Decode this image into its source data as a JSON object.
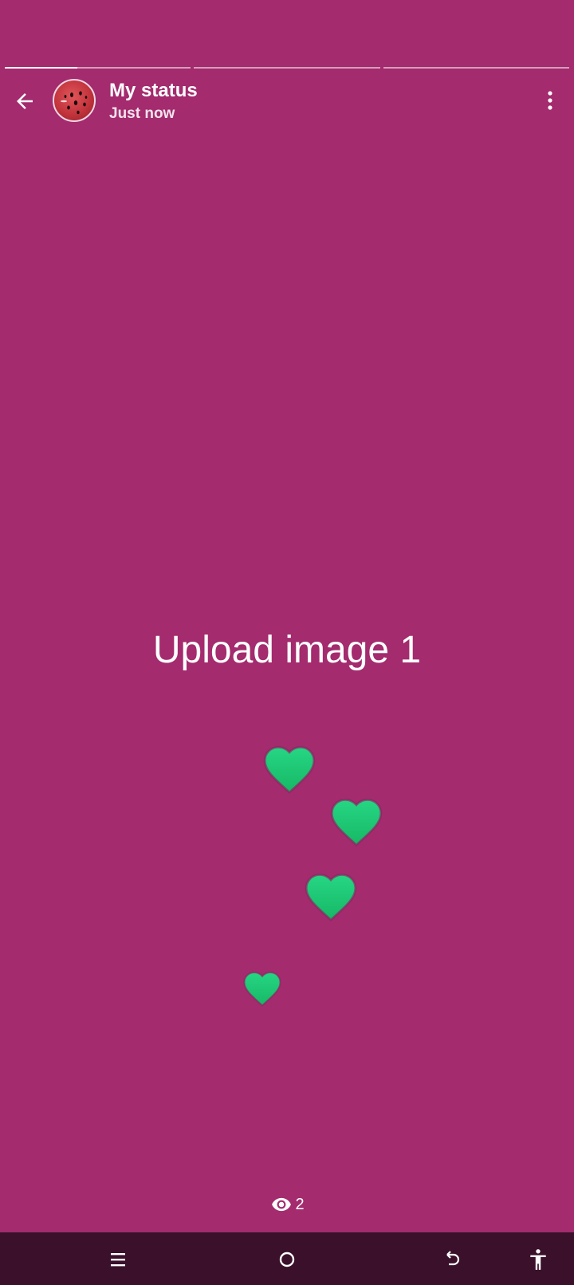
{
  "story": {
    "segments": [
      {
        "progress": 0.39
      },
      {
        "progress": 0
      },
      {
        "progress": 0
      }
    ]
  },
  "header": {
    "back_icon": "arrow-left-icon",
    "avatar": "watermelon-avatar",
    "title": "My status",
    "subtitle": "Just now",
    "menu_icon": "more-vertical-icon"
  },
  "content": {
    "text": "Upload image 1",
    "background_color": "#a32b6e",
    "reaction_icon": "heart-icon",
    "reaction_color": "#22c97a"
  },
  "footer": {
    "views_icon": "eye-icon",
    "views_count": "2"
  },
  "navbar": {
    "buttons": [
      "menu-icon",
      "home-icon",
      "back-icon",
      "accessibility-icon"
    ]
  }
}
